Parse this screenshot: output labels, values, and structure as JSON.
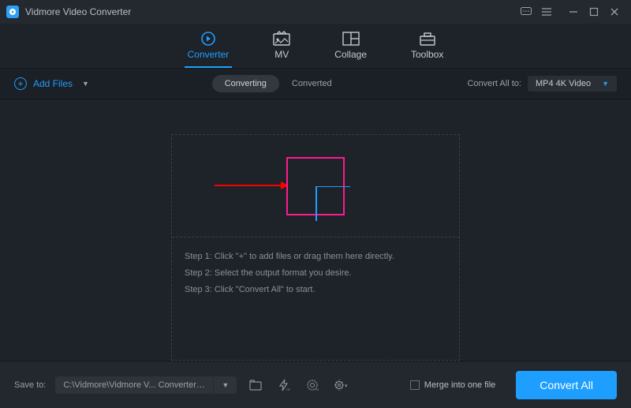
{
  "title": "Vidmore Video Converter",
  "tabs": {
    "converter": "Converter",
    "mv": "MV",
    "collage": "Collage",
    "toolbox": "Toolbox"
  },
  "toolbar": {
    "add_files": "Add Files",
    "converting": "Converting",
    "converted": "Converted",
    "convert_all_to": "Convert All to:",
    "format_selected": "MP4 4K Video"
  },
  "steps": {
    "s1": "Step 1: Click \"+\" to add files or drag them here directly.",
    "s2": "Step 2: Select the output format you desire.",
    "s3": "Step 3: Click \"Convert All\" to start."
  },
  "footer": {
    "save_to_label": "Save to:",
    "save_path": "C:\\Vidmore\\Vidmore V... Converter\\Converted",
    "merge_label": "Merge into one file",
    "convert_all_btn": "Convert All"
  }
}
